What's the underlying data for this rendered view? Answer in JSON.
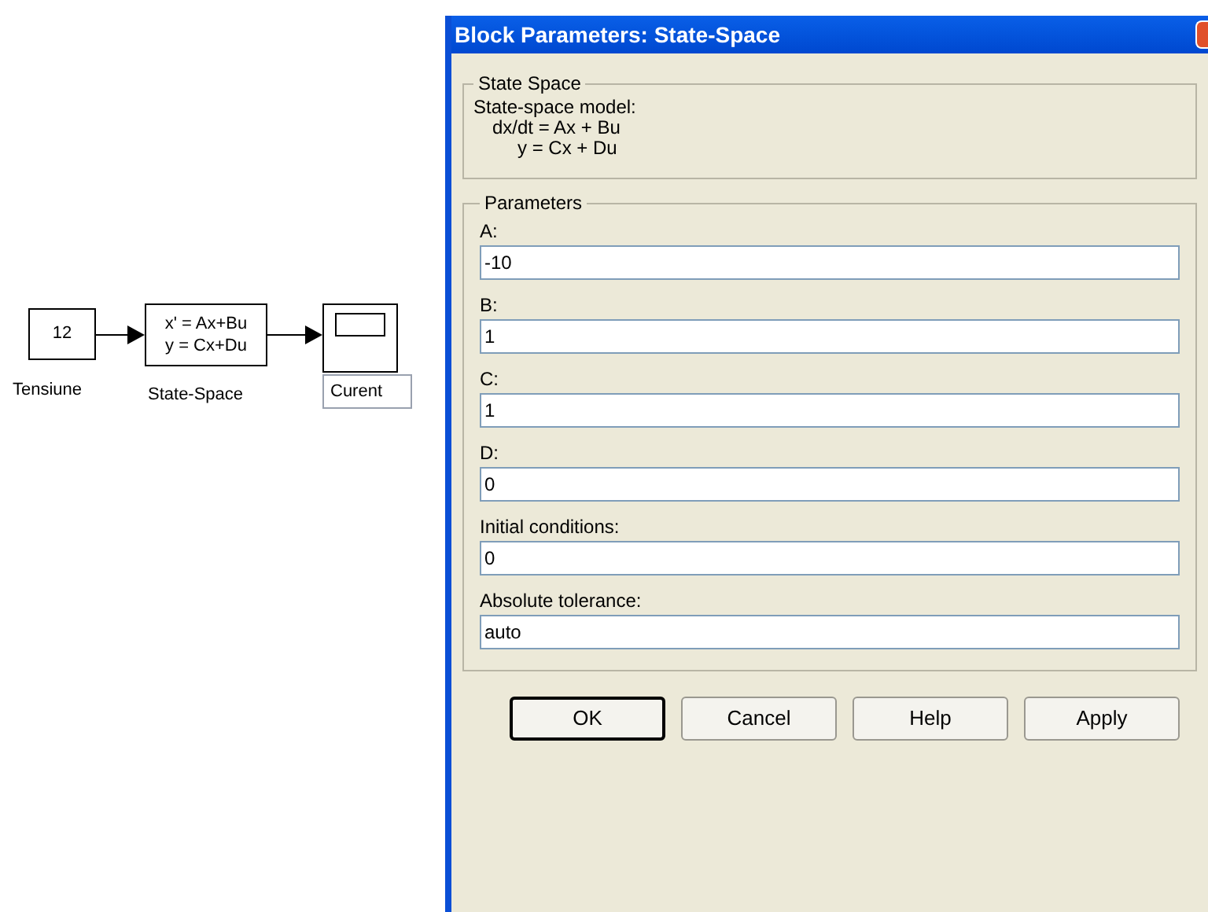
{
  "diagram": {
    "blocks": [
      {
        "kind": "constant",
        "value": "12",
        "label": "Tensiune"
      },
      {
        "kind": "state_space",
        "lines": [
          "x' = Ax+Bu",
          "y = Cx+Du"
        ],
        "label": "State-Space"
      },
      {
        "kind": "scope",
        "label": "Curent"
      }
    ]
  },
  "dialog": {
    "title": "Block Parameters: State-Space",
    "description": {
      "legend": "State Space",
      "lines": [
        "State-space model:",
        "dx/dt = Ax + Bu",
        "y = Cx + Du"
      ]
    },
    "parameters": {
      "legend": "Parameters",
      "fields": [
        {
          "label": "A:",
          "value": "-10"
        },
        {
          "label": "B:",
          "value": "1"
        },
        {
          "label": "C:",
          "value": "1"
        },
        {
          "label": "D:",
          "value": "0"
        },
        {
          "label": "Initial conditions:",
          "value": "0"
        },
        {
          "label": "Absolute tolerance:",
          "value": "auto"
        }
      ]
    },
    "buttons": [
      {
        "label": "OK",
        "default": true
      },
      {
        "label": "Cancel",
        "default": false
      },
      {
        "label": "Help",
        "default": false
      },
      {
        "label": "Apply",
        "default": false
      }
    ]
  }
}
